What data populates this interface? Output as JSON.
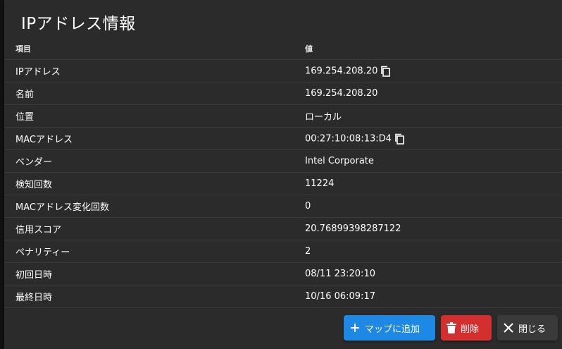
{
  "dialog": {
    "title": "IPアドレス情報",
    "columns": {
      "key": "項目",
      "value": "値"
    },
    "rows": [
      {
        "label": "IPアドレス",
        "value": "169.254.208.20",
        "copyable": true
      },
      {
        "label": "名前",
        "value": "169.254.208.20",
        "copyable": false
      },
      {
        "label": "位置",
        "value": "ローカル",
        "copyable": false
      },
      {
        "label": "MACアドレス",
        "value": "00:27:10:08:13:D4",
        "copyable": true
      },
      {
        "label": "ベンダー",
        "value": "Intel Corporate",
        "copyable": false
      },
      {
        "label": "検知回数",
        "value": "11224",
        "copyable": false
      },
      {
        "label": "MACアドレス変化回数",
        "value": "0",
        "copyable": false
      },
      {
        "label": "信用スコア",
        "value": "20.76899398287122",
        "copyable": false
      },
      {
        "label": "ペナリティー",
        "value": "2",
        "copyable": false
      },
      {
        "label": "初回日時",
        "value": "08/11 23:20:10",
        "copyable": false
      },
      {
        "label": "最終日時",
        "value": "10/16 06:09:17",
        "copyable": false
      }
    ],
    "buttons": {
      "add_to_map": "マップに追加",
      "delete": "削除",
      "close": "閉じる"
    }
  },
  "icons": {
    "copy": "copy-icon",
    "plus": "plus-icon",
    "trash": "trash-icon",
    "close": "close-icon"
  },
  "colors": {
    "primary": "#1e88e5",
    "danger": "#d32f2f",
    "dialog_bg": "#2b2b2b"
  }
}
